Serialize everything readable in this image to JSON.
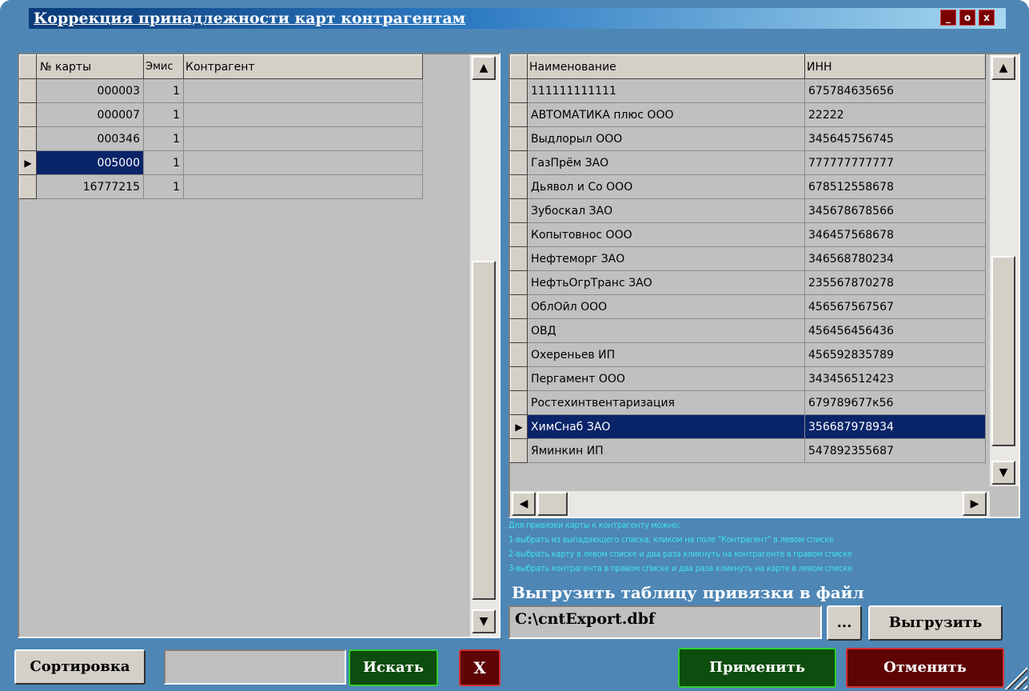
{
  "window": {
    "title": "Коррекция принадлежности карт контрагентам",
    "minimize": "_",
    "maximize": "o",
    "close": "x"
  },
  "cards_grid": {
    "columns": [
      "№ карты",
      "Эмис",
      "Контрагент"
    ],
    "rows": [
      {
        "card": "000003",
        "emis": "1",
        "contractor": ""
      },
      {
        "card": "000007",
        "emis": "1",
        "contractor": ""
      },
      {
        "card": "000346",
        "emis": "1",
        "contractor": ""
      },
      {
        "card": "005000",
        "emis": "1",
        "contractor": "",
        "selected": true
      },
      {
        "card": "16777215",
        "emis": "1",
        "contractor": ""
      }
    ]
  },
  "contractors_grid": {
    "columns": [
      "Наименование",
      "ИНН"
    ],
    "rows": [
      {
        "name": "111111111111",
        "inn": "675784635656"
      },
      {
        "name": "АВТОМАТИКА плюс ООО",
        "inn": "22222"
      },
      {
        "name": "Выдлорыл ООО",
        "inn": "345645756745"
      },
      {
        "name": "ГазПрём ЗАО",
        "inn": "777777777777"
      },
      {
        "name": "Дьявол и Со ООО",
        "inn": "678512558678"
      },
      {
        "name": "Зубоскал ЗАО",
        "inn": "345678678566"
      },
      {
        "name": "Копытовнос ООО",
        "inn": "346457568678"
      },
      {
        "name": "Нефтеморг ЗАО",
        "inn": "346568780234"
      },
      {
        "name": "НефтьОгрТранс ЗАО",
        "inn": "235567870278"
      },
      {
        "name": "ОблОйл ООО",
        "inn": "456567567567"
      },
      {
        "name": "ОВД",
        "inn": "456456456436"
      },
      {
        "name": "Охереньев ИП",
        "inn": "456592835789"
      },
      {
        "name": "Пергамент ООО",
        "inn": "343456512423"
      },
      {
        "name": "Ростехинтвентаризация",
        "inn": "679789677к56"
      },
      {
        "name": "ХимСнаб ЗАО",
        "inn": "356687978934",
        "selected": true
      },
      {
        "name": "Яминкин ИП",
        "inn": "547892355687"
      }
    ]
  },
  "hints": [
    "Для привязки карты к контрагенту можно:",
    "1-выбрать из выпадающего списка, кликом на поле \"Контрагент\" в левом списке",
    "2-выбрать карту в левом списке и два раза кликнуть на контрагенте в правом списке",
    "3-выбрать контрагента в правом списке и два раза кликнуть на карте в левом списке"
  ],
  "export": {
    "title": "Выгрузить таблицу привязки в файл",
    "path": "C:\\cntExport.dbf",
    "browse_label": "...",
    "export_label": "Выгрузить"
  },
  "bottom": {
    "sort_label": "Сортировка",
    "search_value": "",
    "search_label": "Искать",
    "clear_label": "X",
    "apply_label": "Применить",
    "cancel_label": "Отменить"
  },
  "colors": {
    "window_bg": "#4e86b5",
    "selection": "#0a246a",
    "hint_text": "#40e0f0",
    "green_button": "#0d4d0d",
    "red_button": "#5e0404"
  }
}
